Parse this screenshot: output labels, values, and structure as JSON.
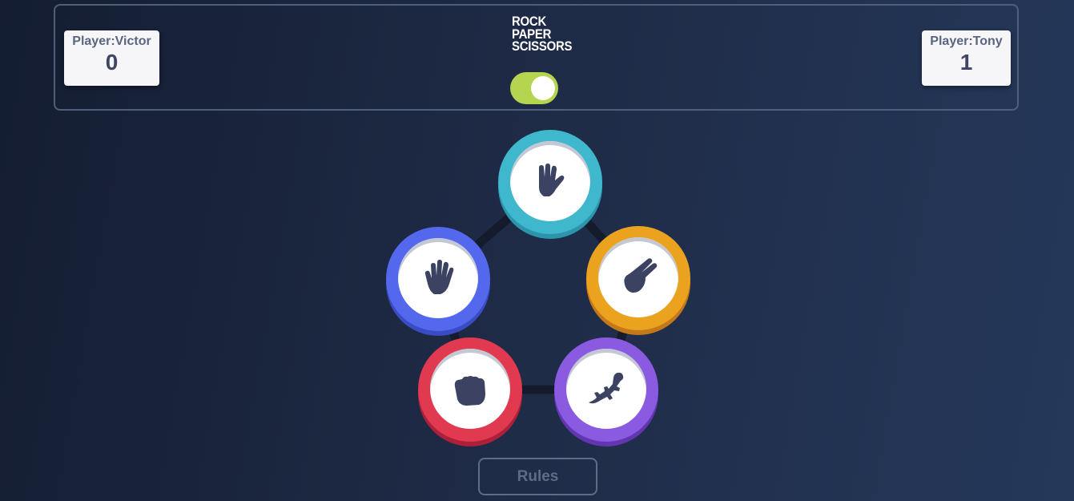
{
  "header": {
    "logo_lines": [
      "ROCK",
      "PAPER",
      "SCISSORS"
    ],
    "left_player": {
      "label": "Player:Victor",
      "score": "0"
    },
    "right_player": {
      "label": "Player:Tony",
      "score": "1"
    },
    "toggle": {
      "state": "on",
      "color": "#b5d44f"
    }
  },
  "choices": [
    {
      "id": "spock",
      "icon": "spock-hand-icon",
      "color": "#3fb7cd"
    },
    {
      "id": "paper",
      "icon": "paper-hand-icon",
      "color": "#5468ee"
    },
    {
      "id": "scissors",
      "icon": "scissors-hand-icon",
      "color": "#eba21f"
    },
    {
      "id": "rock",
      "icon": "rock-fist-icon",
      "color": "#e1394f"
    },
    {
      "id": "lizard",
      "icon": "lizard-icon",
      "color": "#8a5ae0"
    }
  ],
  "footer": {
    "rules_label": "Rules"
  },
  "colors": {
    "background": "#1e2a45",
    "icon": "#3b4262",
    "card_text": "#5b6580"
  }
}
